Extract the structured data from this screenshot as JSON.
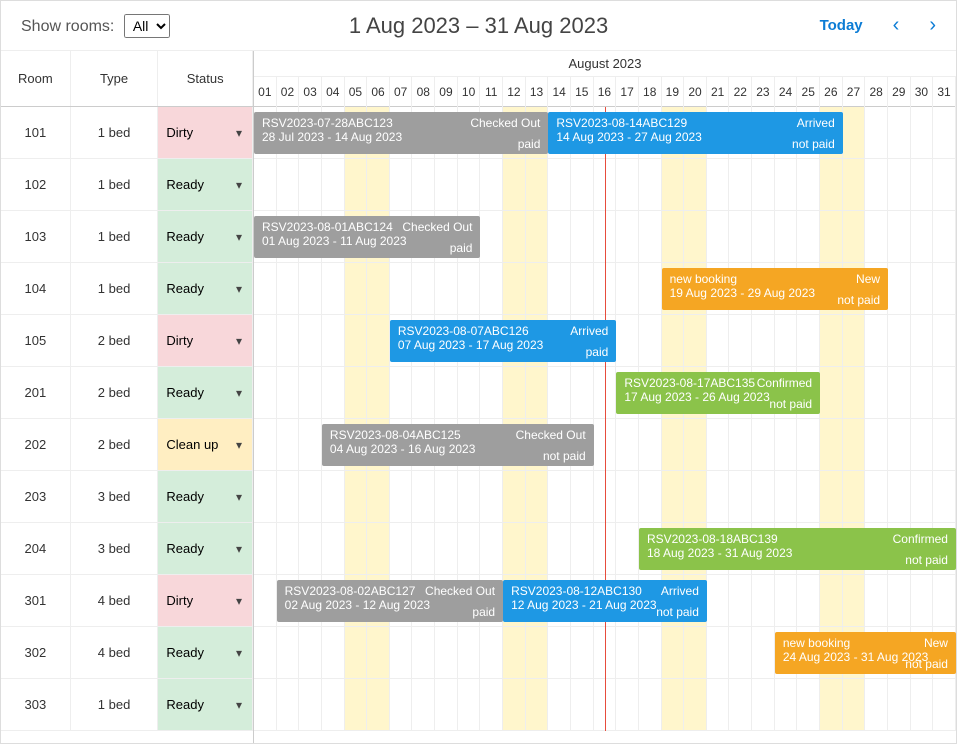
{
  "toolbar": {
    "show_rooms_label": "Show rooms:",
    "filter_value": "All",
    "date_range": "1 Aug 2023 – 31 Aug 2023",
    "today_label": "Today"
  },
  "headers": {
    "room": "Room",
    "type": "Type",
    "status": "Status",
    "month": "August 2023"
  },
  "days": [
    "01",
    "02",
    "03",
    "04",
    "05",
    "06",
    "07",
    "08",
    "09",
    "10",
    "11",
    "12",
    "13",
    "14",
    "15",
    "16",
    "17",
    "18",
    "19",
    "20",
    "21",
    "22",
    "23",
    "24",
    "25",
    "26",
    "27",
    "28",
    "29",
    "30",
    "31"
  ],
  "weekends": [
    5,
    6,
    12,
    13,
    19,
    20,
    26,
    27
  ],
  "today_col": 16,
  "rooms": [
    {
      "room": "101",
      "type": "1 bed",
      "status": "Dirty",
      "status_class": "dirty"
    },
    {
      "room": "102",
      "type": "1 bed",
      "status": "Ready",
      "status_class": "ready"
    },
    {
      "room": "103",
      "type": "1 bed",
      "status": "Ready",
      "status_class": "ready"
    },
    {
      "room": "104",
      "type": "1 bed",
      "status": "Ready",
      "status_class": "ready"
    },
    {
      "room": "105",
      "type": "2 bed",
      "status": "Dirty",
      "status_class": "dirty"
    },
    {
      "room": "201",
      "type": "2 bed",
      "status": "Ready",
      "status_class": "ready"
    },
    {
      "room": "202",
      "type": "2 bed",
      "status": "Clean up",
      "status_class": "cleanup"
    },
    {
      "room": "203",
      "type": "3 bed",
      "status": "Ready",
      "status_class": "ready"
    },
    {
      "room": "204",
      "type": "3 bed",
      "status": "Ready",
      "status_class": "ready"
    },
    {
      "room": "301",
      "type": "4 bed",
      "status": "Dirty",
      "status_class": "dirty"
    },
    {
      "room": "302",
      "type": "4 bed",
      "status": "Ready",
      "status_class": "ready"
    },
    {
      "room": "303",
      "type": "1 bed",
      "status": "Ready",
      "status_class": "ready"
    }
  ],
  "bookings": [
    {
      "row": 0,
      "start": 0,
      "end": 14,
      "color": "c-gray",
      "id": "RSV2023-07-28ABC123",
      "dates": "28 Jul 2023 - 14 Aug 2023",
      "status": "Checked Out",
      "pay": "paid",
      "clip_left": true
    },
    {
      "row": 0,
      "start": 14,
      "end": 27,
      "color": "c-blue",
      "id": "RSV2023-08-14ABC129",
      "dates": "14 Aug 2023 - 27 Aug 2023",
      "status": "Arrived",
      "pay": "not paid"
    },
    {
      "row": 2,
      "start": 1,
      "end": 11,
      "color": "c-gray",
      "id": "RSV2023-08-01ABC124",
      "dates": "01 Aug 2023 - 11 Aug 2023",
      "status": "Checked Out",
      "pay": "paid"
    },
    {
      "row": 3,
      "start": 19,
      "end": 29,
      "color": "c-orange",
      "id": "new booking",
      "dates": "19 Aug 2023 - 29 Aug 2023",
      "status": "New",
      "pay": "not paid"
    },
    {
      "row": 4,
      "start": 7,
      "end": 17,
      "color": "c-blue",
      "id": "RSV2023-08-07ABC126",
      "dates": "07 Aug 2023 - 17 Aug 2023",
      "status": "Arrived",
      "pay": "paid"
    },
    {
      "row": 5,
      "start": 17,
      "end": 26,
      "color": "c-green",
      "id": "RSV2023-08-17ABC135",
      "dates": "17 Aug 2023 - 26 Aug 2023",
      "status": "Confirmed",
      "pay": "not paid"
    },
    {
      "row": 6,
      "start": 4,
      "end": 16,
      "color": "c-gray",
      "id": "RSV2023-08-04ABC125",
      "dates": "04 Aug 2023 - 16 Aug 2023",
      "status": "Checked Out",
      "pay": "not paid"
    },
    {
      "row": 8,
      "start": 18,
      "end": 32,
      "color": "c-green",
      "id": "RSV2023-08-18ABC139",
      "dates": "18 Aug 2023 - 31 Aug 2023",
      "status": "Confirmed",
      "pay": "not paid",
      "clip_right": true
    },
    {
      "row": 9,
      "start": 2,
      "end": 12,
      "color": "c-gray",
      "id": "RSV2023-08-02ABC127",
      "dates": "02 Aug 2023 - 12 Aug 2023",
      "status": "Checked Out",
      "pay": "paid"
    },
    {
      "row": 9,
      "start": 12,
      "end": 21,
      "color": "c-blue",
      "id": "RSV2023-08-12ABC130",
      "dates": "12 Aug 2023 - 21 Aug 2023",
      "status": "Arrived",
      "pay": "not paid"
    },
    {
      "row": 10,
      "start": 24,
      "end": 32,
      "color": "c-orange",
      "id": "new booking",
      "dates": "24 Aug 2023 - 31 Aug 2023",
      "status": "New",
      "pay": "not paid",
      "clip_right": true
    }
  ]
}
